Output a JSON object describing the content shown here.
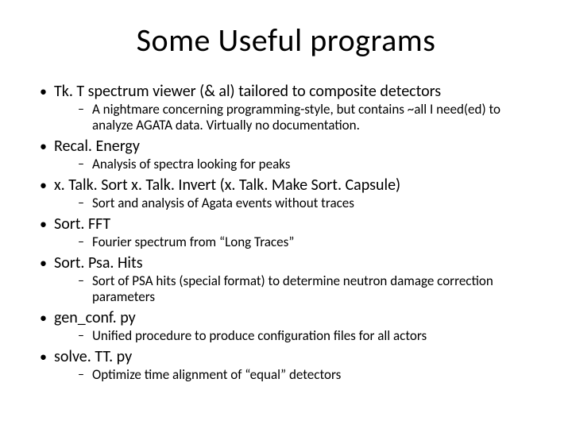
{
  "title": "Some Useful programs",
  "items": [
    {
      "label": "Tk. T spectrum viewer (& al) tailored to composite detectors",
      "sub": [
        "A nightmare concerning  programming-style, but contains ~all I need(ed) to analyze AGATA data. Virtually no documentation."
      ]
    },
    {
      "label": "Recal. Energy",
      "sub": [
        "Analysis of spectra looking for peaks"
      ]
    },
    {
      "label": "x. Talk. Sort x. Talk. Invert (x. Talk. Make Sort. Capsule)",
      "sub": [
        "Sort and analysis of Agata events without traces"
      ]
    },
    {
      "label": "Sort. FFT",
      "sub": [
        "Fourier spectrum  from “Long Traces”"
      ]
    },
    {
      "label": "Sort. Psa. Hits",
      "sub": [
        "Sort of PSA hits (special format) to determine neutron damage correction parameters"
      ]
    },
    {
      "label": "gen_conf. py",
      "sub": [
        "Unified procedure to produce configuration files for all actors"
      ]
    },
    {
      "label": "solve. TT. py",
      "sub": [
        "Optimize time alignment of “equal” detectors"
      ]
    }
  ]
}
